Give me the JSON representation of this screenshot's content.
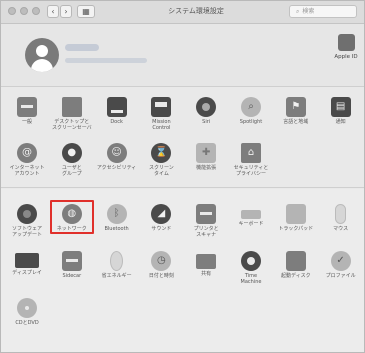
{
  "window": {
    "title": "システム環境設定",
    "back_glyph": "‹",
    "forward_glyph": "›",
    "grid_glyph": "▦",
    "search_placeholder": "検索"
  },
  "account": {
    "apple_id_label": "Apple ID",
    "apple_glyph": ""
  },
  "section1": [
    {
      "key": "general",
      "label": "一般",
      "icon": "general-icon"
    },
    {
      "key": "desktop",
      "label": "デスクトップと\nスクリーンセーバ",
      "icon": "desktop-icon"
    },
    {
      "key": "dock",
      "label": "Dock",
      "icon": "dock-icon"
    },
    {
      "key": "mission",
      "label": "Mission\nControl",
      "icon": "mission-control-icon"
    },
    {
      "key": "siri",
      "label": "Siri",
      "icon": "siri-icon"
    },
    {
      "key": "spotlight",
      "label": "Spotlight",
      "icon": "spotlight-icon"
    },
    {
      "key": "language",
      "label": "言語と地域",
      "icon": "flag-icon"
    },
    {
      "key": "notifications",
      "label": "通知",
      "icon": "notifications-icon"
    },
    {
      "key": "internet",
      "label": "インターネット\nアカウント",
      "icon": "at-icon"
    },
    {
      "key": "users",
      "label": "ユーザと\nグループ",
      "icon": "users-icon"
    },
    {
      "key": "accessibility",
      "label": "アクセシビリティ",
      "icon": "accessibility-icon"
    },
    {
      "key": "screentime",
      "label": "スクリーン\nタイム",
      "icon": "hourglass-icon"
    },
    {
      "key": "extensions",
      "label": "機能拡張",
      "icon": "puzzle-icon"
    },
    {
      "key": "security",
      "label": "セキュリティと\nプライバシー",
      "icon": "house-lock-icon"
    }
  ],
  "section2": [
    {
      "key": "software",
      "label": "ソフトウェア\nアップデート",
      "icon": "gear-icon"
    },
    {
      "key": "network",
      "label": "ネットワーク",
      "icon": "globe-icon",
      "highlight": true
    },
    {
      "key": "bluetooth",
      "label": "Bluetooth",
      "icon": "bluetooth-icon"
    },
    {
      "key": "sound",
      "label": "サウンド",
      "icon": "speaker-icon"
    },
    {
      "key": "printers",
      "label": "プリンタと\nスキャナ",
      "icon": "printer-icon"
    },
    {
      "key": "keyboard",
      "label": "キーボード",
      "icon": "keyboard-icon"
    },
    {
      "key": "trackpad",
      "label": "トラックパッド",
      "icon": "trackpad-icon"
    },
    {
      "key": "mouse",
      "label": "マウス",
      "icon": "mouse-icon"
    },
    {
      "key": "displays",
      "label": "ディスプレイ",
      "icon": "display-icon"
    },
    {
      "key": "sidecar",
      "label": "Sidecar",
      "icon": "sidecar-icon"
    },
    {
      "key": "energy",
      "label": "省エネルギー",
      "icon": "lightbulb-icon"
    },
    {
      "key": "datetime",
      "label": "日付と時刻",
      "icon": "clock-icon"
    },
    {
      "key": "sharing",
      "label": "共有",
      "icon": "folder-icon"
    },
    {
      "key": "timemachine",
      "label": "Time\nMachine",
      "icon": "time-machine-icon"
    },
    {
      "key": "startup",
      "label": "起動ディスク",
      "icon": "disk-icon"
    },
    {
      "key": "profiles",
      "label": "プロファイル",
      "icon": "badge-check-icon"
    },
    {
      "key": "cddvd",
      "label": "CDとDVD",
      "icon": "cd-dvd-icon"
    }
  ],
  "colors": {
    "highlight_frame": "#e0302b"
  }
}
